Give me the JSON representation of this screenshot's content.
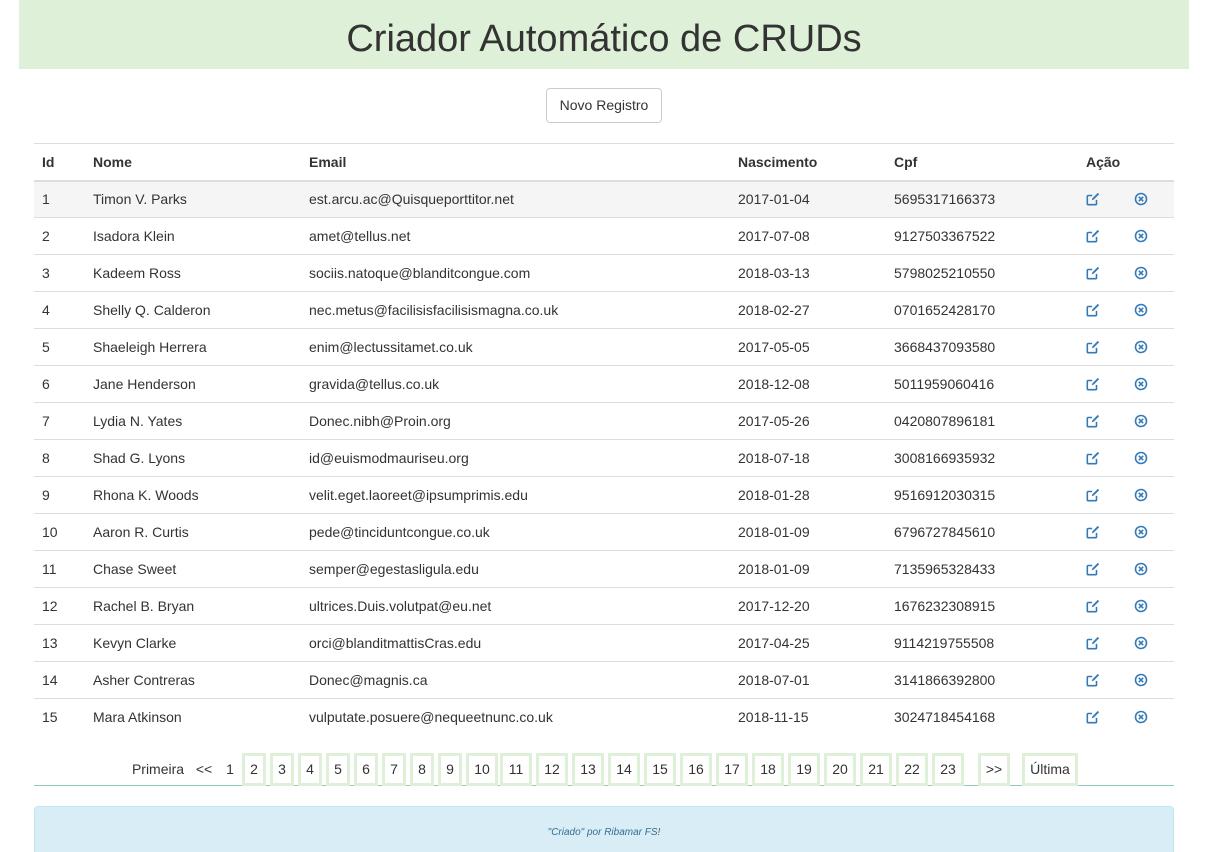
{
  "header": {
    "title": "Criador Automático de CRUDs"
  },
  "toolbar": {
    "new_label": "Novo Registro"
  },
  "table": {
    "columns": [
      "Id",
      "Nome",
      "Email",
      "Nascimento",
      "Cpf",
      "Ação"
    ],
    "rows": [
      {
        "id": "1",
        "nome": "Timon V. Parks",
        "email": "est.arcu.ac@Quisqueporttitor.net",
        "nascimento": "2017-01-04",
        "cpf": "5695317166373"
      },
      {
        "id": "2",
        "nome": "Isadora Klein",
        "email": "amet@tellus.net",
        "nascimento": "2017-07-08",
        "cpf": "9127503367522"
      },
      {
        "id": "3",
        "nome": "Kadeem Ross",
        "email": "sociis.natoque@blanditcongue.com",
        "nascimento": "2018-03-13",
        "cpf": "5798025210550"
      },
      {
        "id": "4",
        "nome": "Shelly Q. Calderon",
        "email": "nec.metus@facilisisfacilisismagna.co.uk",
        "nascimento": "2018-02-27",
        "cpf": "0701652428170"
      },
      {
        "id": "5",
        "nome": "Shaeleigh Herrera",
        "email": "enim@lectussitamet.co.uk",
        "nascimento": "2017-05-05",
        "cpf": "3668437093580"
      },
      {
        "id": "6",
        "nome": "Jane Henderson",
        "email": "gravida@tellus.co.uk",
        "nascimento": "2018-12-08",
        "cpf": "5011959060416"
      },
      {
        "id": "7",
        "nome": "Lydia N. Yates",
        "email": "Donec.nibh@Proin.org",
        "nascimento": "2017-05-26",
        "cpf": "0420807896181"
      },
      {
        "id": "8",
        "nome": "Shad G. Lyons",
        "email": "id@euismodmauriseu.org",
        "nascimento": "2018-07-18",
        "cpf": "3008166935932"
      },
      {
        "id": "9",
        "nome": "Rhona K. Woods",
        "email": "velit.eget.laoreet@ipsumprimis.edu",
        "nascimento": "2018-01-28",
        "cpf": "9516912030315"
      },
      {
        "id": "10",
        "nome": "Aaron R. Curtis",
        "email": "pede@tinciduntcongue.co.uk",
        "nascimento": "2018-01-09",
        "cpf": "6796727845610"
      },
      {
        "id": "11",
        "nome": "Chase Sweet",
        "email": "semper@egestasligula.edu",
        "nascimento": "2018-01-09",
        "cpf": "7135965328433"
      },
      {
        "id": "12",
        "nome": "Rachel B. Bryan",
        "email": "ultrices.Duis.volutpat@eu.net",
        "nascimento": "2017-12-20",
        "cpf": "1676232308915"
      },
      {
        "id": "13",
        "nome": "Kevyn Clarke",
        "email": "orci@blanditmattisCras.edu",
        "nascimento": "2017-04-25",
        "cpf": "9114219755508"
      },
      {
        "id": "14",
        "nome": "Asher Contreras",
        "email": "Donec@magnis.ca",
        "nascimento": "2018-07-01",
        "cpf": "3141866392800"
      },
      {
        "id": "15",
        "nome": "Mara Atkinson",
        "email": "vulputate.posuere@nequeetnunc.co.uk",
        "nascimento": "2018-11-15",
        "cpf": "3024718454168"
      }
    ],
    "actions": {
      "edit_icon": "edit-icon",
      "delete_icon": "delete-circle-icon"
    }
  },
  "pagination": {
    "first": "Primeira",
    "prev": "<<",
    "current": "1",
    "pages": [
      "2",
      "3",
      "4",
      "5",
      "6",
      "7",
      "8",
      "9",
      "10",
      "11",
      "12",
      "13",
      "14",
      "15",
      "16",
      "17",
      "18",
      "19",
      "20",
      "21",
      "22",
      "23"
    ],
    "next": ">>",
    "last": "Última"
  },
  "footer": {
    "text": "\"Criado\" por Ribamar FS!"
  },
  "colors": {
    "header_bg": "#dff0d8",
    "footer_bg": "#d9edf7",
    "footer_text": "#31708f",
    "icon": "#337ab7",
    "page_box_border": "#dff0d8"
  }
}
